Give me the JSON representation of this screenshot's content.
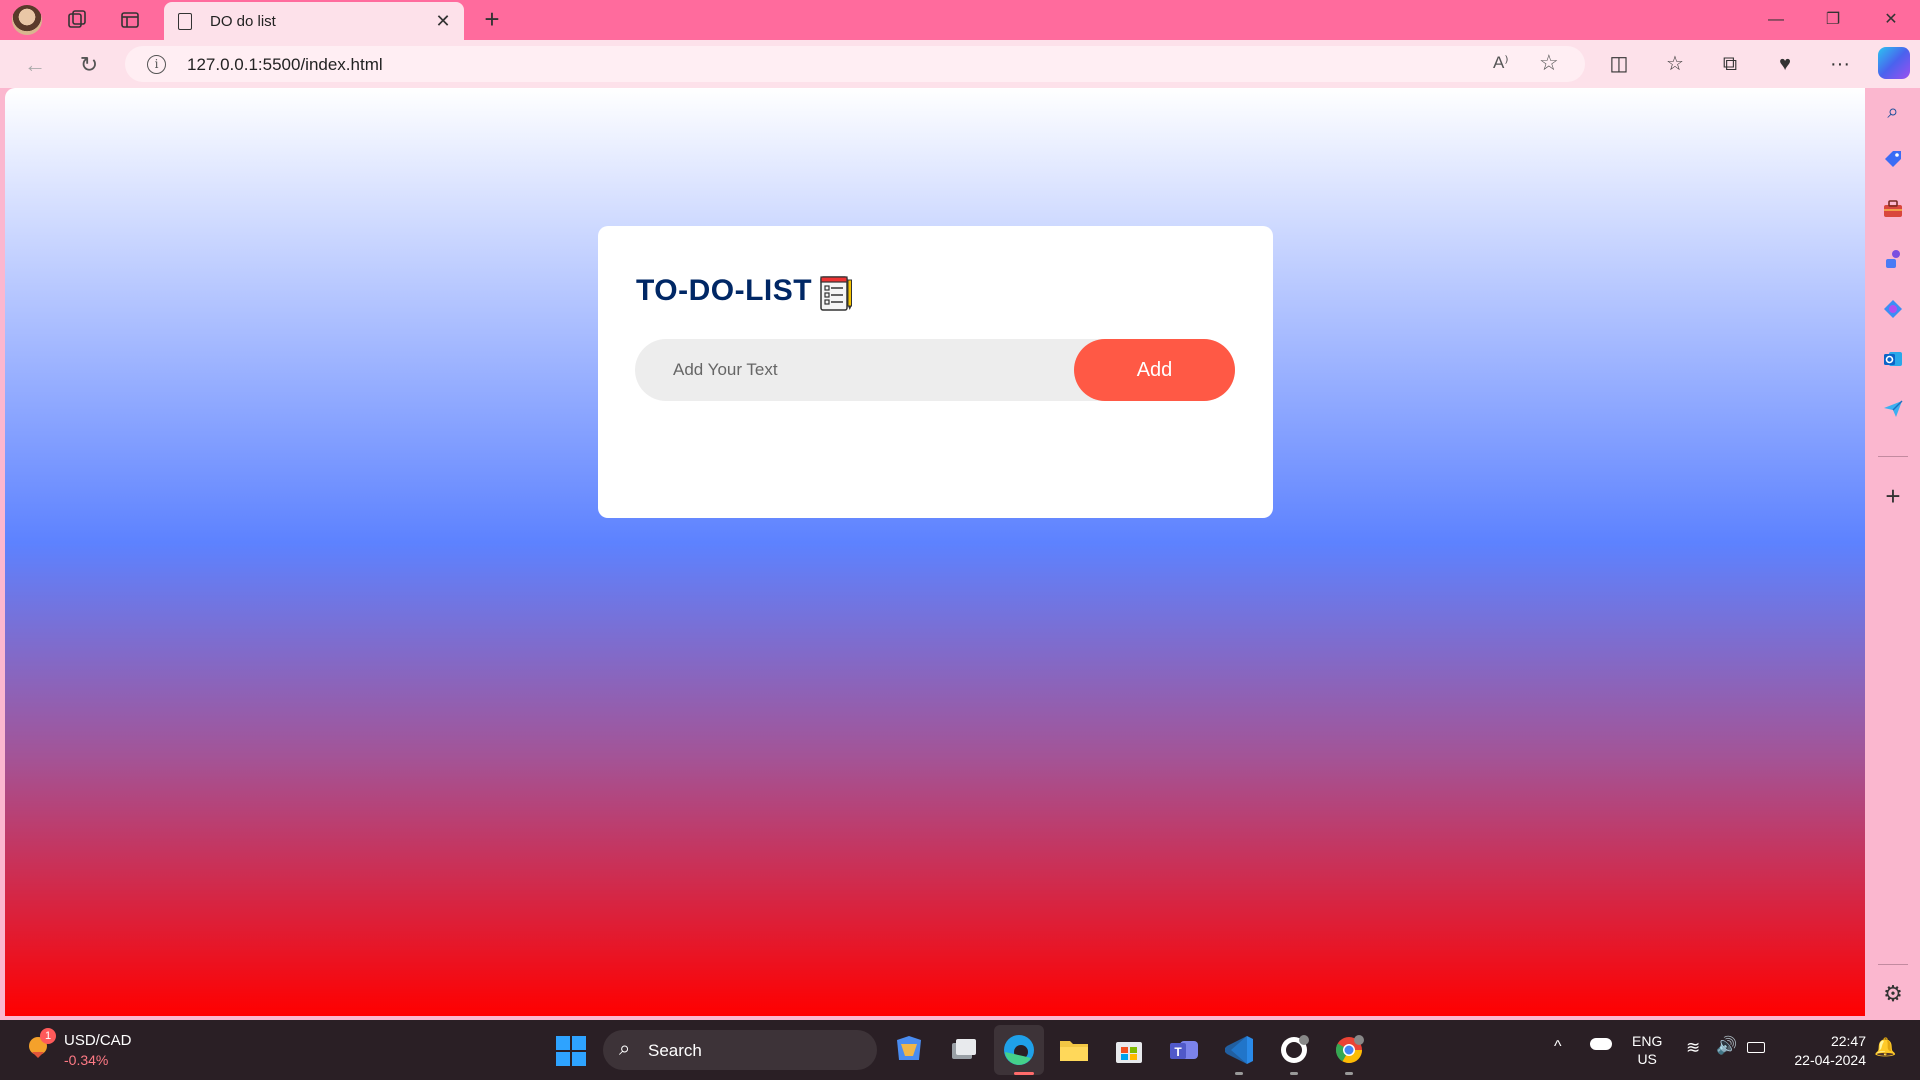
{
  "browser": {
    "tab": {
      "title": "DO do list",
      "close_glyph": "✕"
    },
    "new_tab_glyph": "+",
    "window_controls": {
      "minimize": "—",
      "restore": "❐",
      "close": "✕"
    },
    "address": {
      "url": "127.0.0.1:5500/index.html",
      "info_glyph": "i"
    },
    "read_aloud_glyph": "A⁾",
    "favorite_glyph": "☆",
    "toolbar_glyphs": {
      "split": "◫",
      "favorites": "☆",
      "collections": "⧉",
      "health": "♥",
      "more": "···"
    },
    "nav_glyphs": {
      "back": "←",
      "reload": "↻"
    }
  },
  "app": {
    "title": "TO-DO-LIST",
    "input_placeholder": "Add Your Text",
    "input_value": "",
    "add_button_label": "Add"
  },
  "sidebar": {
    "icons": [
      "search-icon",
      "shopping-tag-icon",
      "toolbox-icon",
      "games-icon",
      "copilot-icon",
      "outlook-icon",
      "send-icon",
      "add-icon",
      "settings-icon"
    ],
    "glyphs": {
      "search": "⌕",
      "add": "+",
      "settings": "⚙"
    }
  },
  "taskbar": {
    "widget": {
      "ticker": "USD/CAD",
      "change": "-0.34%",
      "badge": "1"
    },
    "search_label": "Search",
    "search_glyph": "⌕",
    "tray": {
      "chevron": "^",
      "language": "ENG",
      "region": "US",
      "time": "22:47",
      "date": "22-04-2024",
      "wifi_glyph": "≋",
      "volume_glyph": "🔊",
      "bell_glyph": "🔔"
    }
  },
  "colors": {
    "title_bar": "#ff6b9d",
    "card_title": "#002765",
    "add_button": "#ff5945",
    "input_bg": "#ededed"
  }
}
